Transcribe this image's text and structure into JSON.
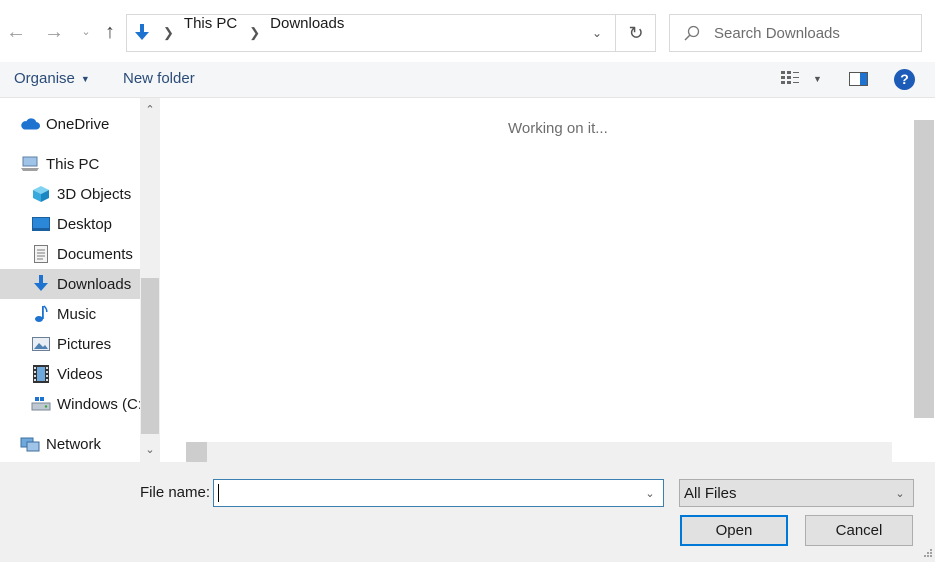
{
  "nav": {
    "back_icon": "arrow-left-icon",
    "forward_icon": "arrow-right-icon",
    "up_icon": "arrow-up-icon",
    "breadcrumb": [
      "This PC",
      "Downloads"
    ]
  },
  "search": {
    "placeholder": "Search Downloads"
  },
  "toolbar": {
    "organise_label": "Organise",
    "new_folder_label": "New folder",
    "help_label": "?"
  },
  "tree": {
    "items": [
      {
        "label": "OneDrive",
        "icon": "cloud-icon"
      },
      {
        "label": "This PC",
        "icon": "computer-icon"
      },
      {
        "label": "3D Objects",
        "icon": "cube-icon"
      },
      {
        "label": "Desktop",
        "icon": "desktop-icon"
      },
      {
        "label": "Documents",
        "icon": "document-icon"
      },
      {
        "label": "Downloads",
        "icon": "download-icon"
      },
      {
        "label": "Music",
        "icon": "music-note-icon"
      },
      {
        "label": "Pictures",
        "icon": "picture-icon"
      },
      {
        "label": "Videos",
        "icon": "film-icon"
      },
      {
        "label": "Windows (C:",
        "icon": "drive-icon"
      },
      {
        "label": "Network",
        "icon": "network-icon"
      }
    ],
    "selected": "Downloads"
  },
  "content": {
    "status": "Working on it..."
  },
  "footer": {
    "file_name_label": "File name:",
    "file_name_value": "",
    "filter_value": "All Files",
    "open_label": "Open",
    "cancel_label": "Cancel"
  },
  "colors": {
    "accent": "#0078d7",
    "selection": "#d9d9d9",
    "link": "#2b4c78",
    "help": "#1c5bb8"
  }
}
